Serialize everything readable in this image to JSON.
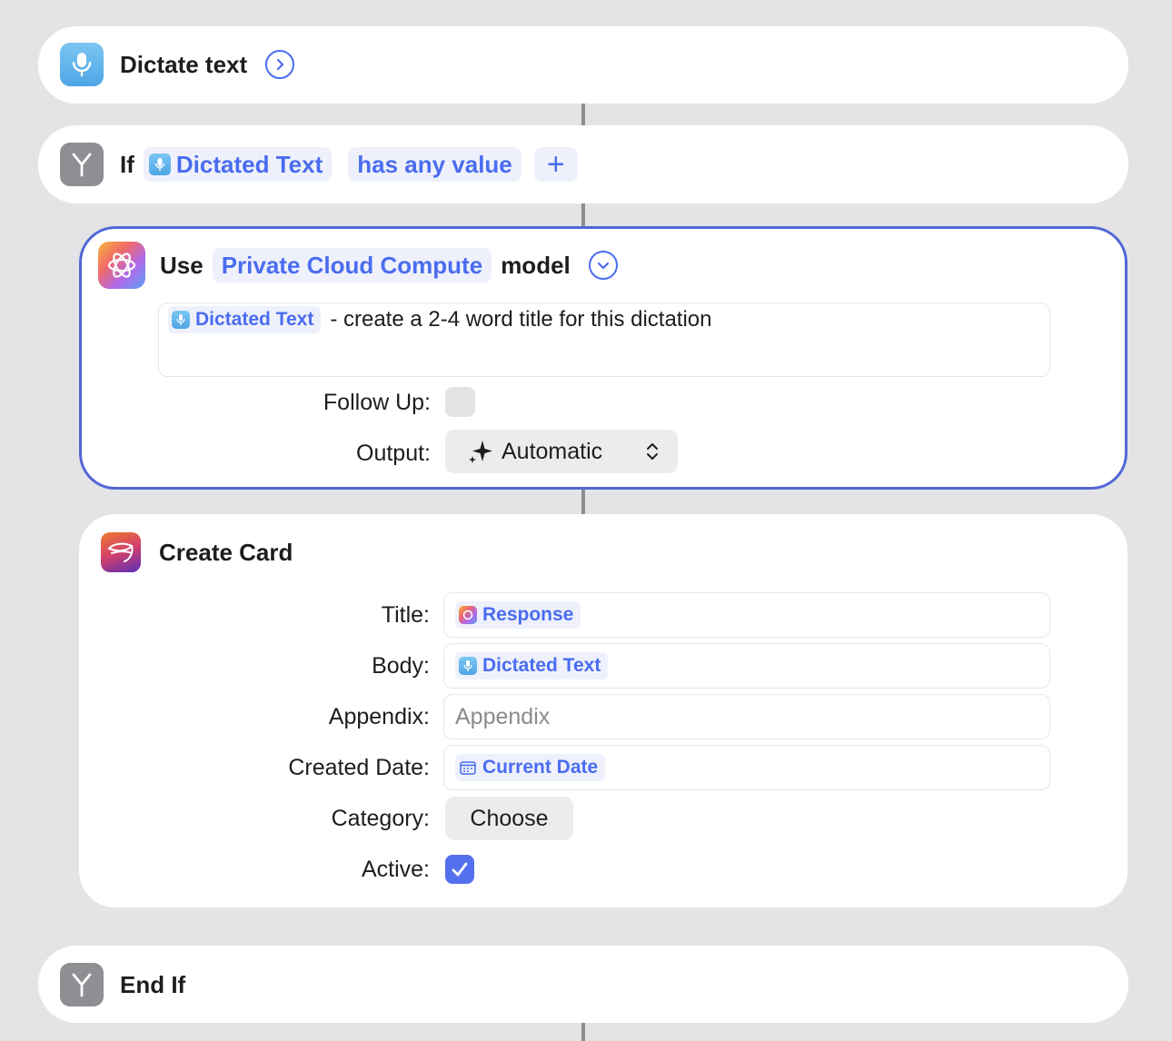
{
  "actions": {
    "dictate": {
      "title": "Dictate text"
    },
    "if_block": {
      "keyword": "If",
      "variable": "Dictated Text",
      "condition": "has any value",
      "add_symbol": "+"
    },
    "model": {
      "use_label": "Use",
      "model_name": "Private Cloud Compute",
      "model_suffix": "model",
      "prompt_variable": "Dictated Text",
      "prompt_text": "- create a 2-4 word title for this dictation",
      "follow_up_label": "Follow Up:",
      "follow_up_checked": false,
      "output_label": "Output:",
      "output_value": "Automatic"
    },
    "create_card": {
      "title": "Create Card",
      "fields": {
        "title_label": "Title:",
        "title_value": "Response",
        "body_label": "Body:",
        "body_value": "Dictated Text",
        "appendix_label": "Appendix:",
        "appendix_placeholder": "Appendix",
        "created_date_label": "Created Date:",
        "created_date_value": "Current Date",
        "category_label": "Category:",
        "category_button": "Choose",
        "active_label": "Active:",
        "active_checked": true
      }
    },
    "end_if": {
      "title": "End If"
    }
  },
  "colors": {
    "accent": "#4a6cf0",
    "token_bg": "#eef1fb",
    "canvas": "#e4e4e6",
    "selected_border": "#5166d6"
  },
  "icons": {
    "dictate": "microphone-icon",
    "if": "branch-icon",
    "model": "apple-intelligence-icon",
    "create_card": "card-app-icon",
    "end_if": "branch-icon"
  }
}
